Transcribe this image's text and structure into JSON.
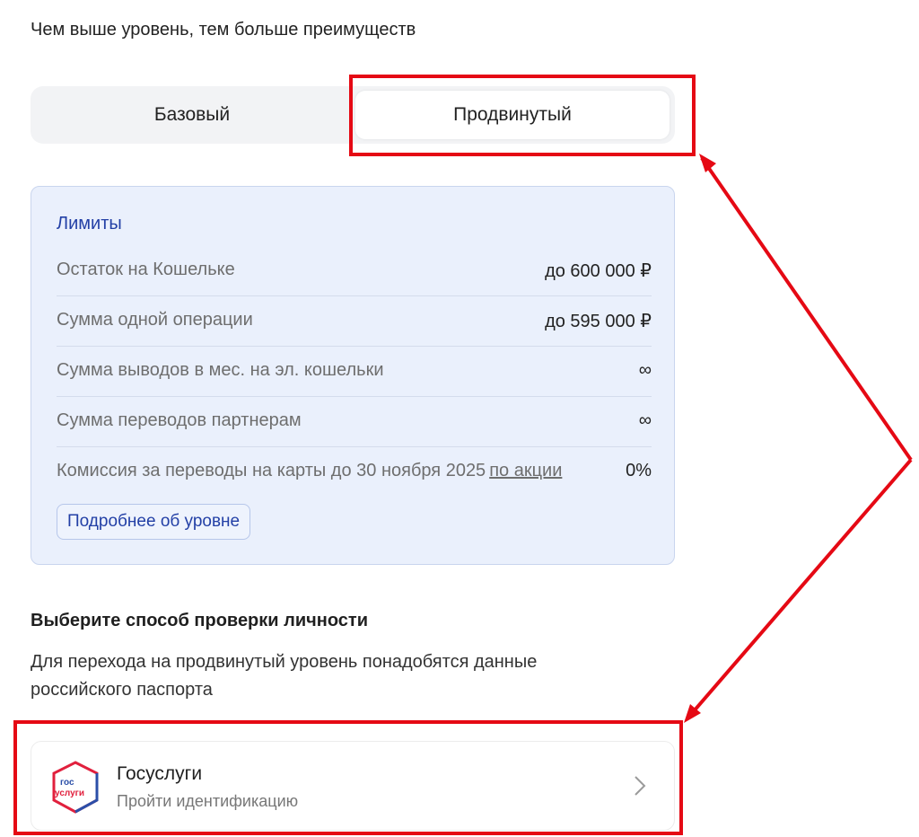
{
  "intro": "Чем выше уровень, тем больше преимуществ",
  "tabs": [
    {
      "label": "Базовый",
      "selected": false
    },
    {
      "label": "Продвинутый",
      "selected": true
    }
  ],
  "limits": {
    "title": "Лимиты",
    "rows": [
      {
        "label": "Остаток на Кошельке",
        "value": "до 600 000 ₽"
      },
      {
        "label": "Сумма одной операции",
        "value": "до 595 000 ₽"
      },
      {
        "label": "Сумма выводов в мес. на эл. кошельки",
        "value": "∞"
      },
      {
        "label": "Сумма переводов партнерам",
        "value": "∞"
      },
      {
        "label": "Комиссия за переводы на карты до 30 ноября 2025",
        "link": "по акции",
        "value": "0%"
      }
    ],
    "more_button": "Подробнее об уровне"
  },
  "verification": {
    "title": "Выберите способ проверки личности",
    "description": "Для перехода на продвинутый уровень понадобятся данные российского паспорта",
    "service": {
      "logo_top": "гос",
      "logo_bottom": "услуги",
      "title": "Госуслуги",
      "subtitle": "Пройти идентификацию",
      "icon": "chevron-right-icon"
    }
  },
  "colors": {
    "accent": "#2340a6",
    "annotation": "#e50914",
    "limits_bg": "#eaf0fc"
  }
}
